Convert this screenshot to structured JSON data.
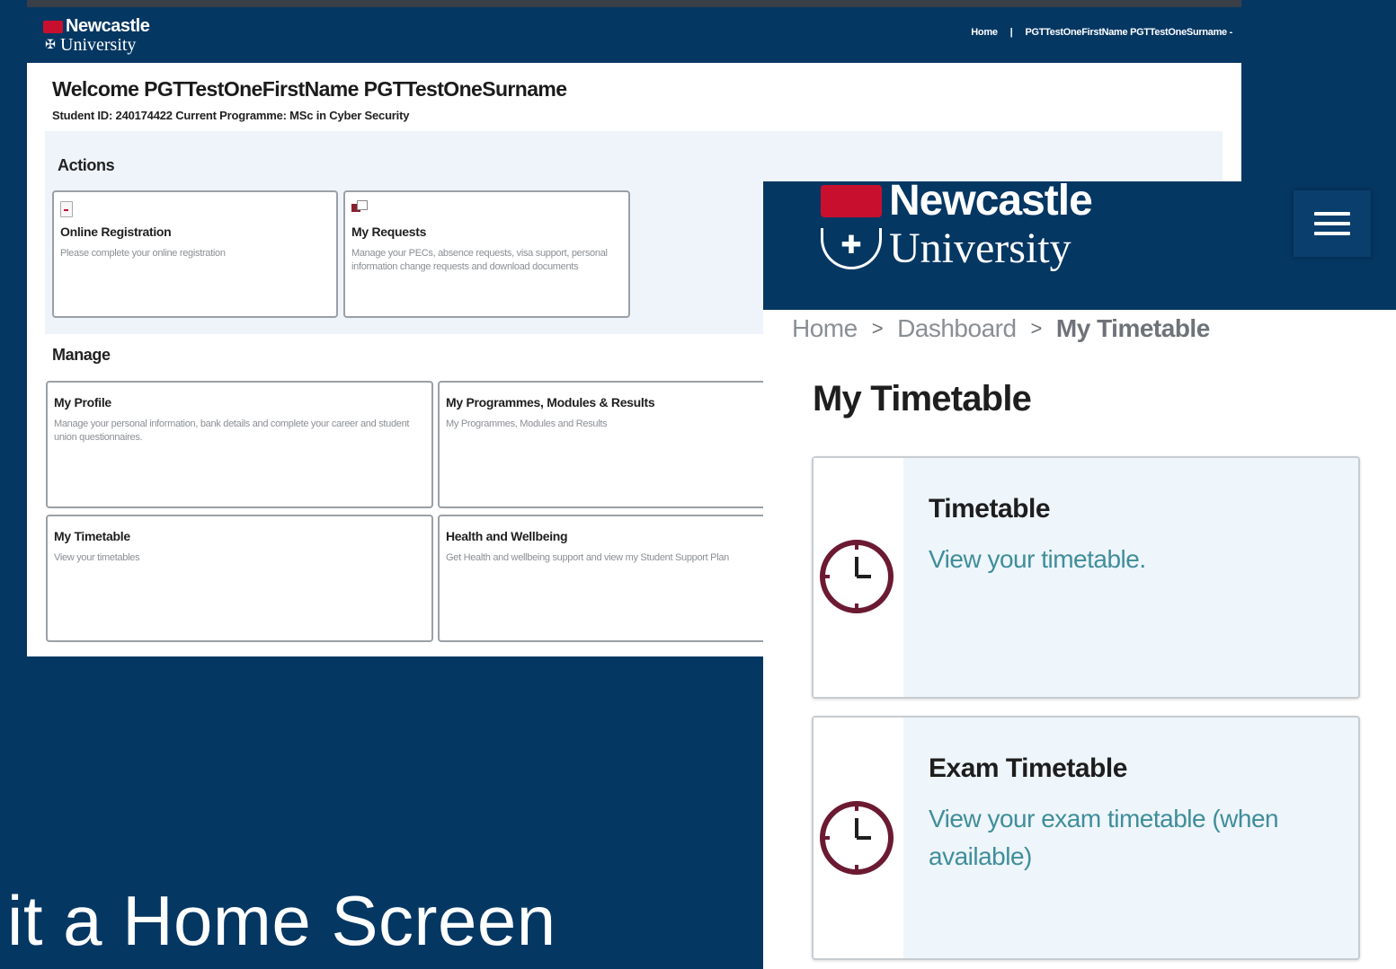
{
  "desktop": {
    "logo": {
      "line1": "Newcastle",
      "line2": "University"
    },
    "nav": {
      "home": "Home",
      "separator": "|",
      "user": "PGTTestOneFirstName PGTTestOneSurname -"
    },
    "welcome": "Welcome PGTTestOneFirstName PGTTestOneSurname",
    "student_info": "Student ID: 240174422 Current Programme: MSc in Cyber Security",
    "actions": {
      "title": "Actions",
      "cards": [
        {
          "title": "Online Registration",
          "desc": "Please complete your online registration",
          "icon": "document-icon"
        },
        {
          "title": "My Requests",
          "desc": "Manage your PECs, absence requests, visa support, personal information change requests and download documents",
          "icon": "requests-icon"
        }
      ]
    },
    "manage": {
      "title": "Manage",
      "cards": [
        {
          "title": "My Profile",
          "desc": "Manage your personal information, bank details and complete your career and student union questionnaires."
        },
        {
          "title": "My Programmes, Modules & Results",
          "desc": "My Programmes, Modules and Results"
        },
        {
          "title": "My Timetable",
          "desc": "View your timetables"
        },
        {
          "title": "Health and Wellbeing",
          "desc": "Get Health and wellbeing support and view my Student Support Plan"
        }
      ]
    }
  },
  "mobile": {
    "logo": {
      "line1": "Newcastle",
      "line2": "University"
    },
    "menu_icon": "hamburger-menu-icon",
    "breadcrumb": {
      "home": "Home",
      "sep": ">",
      "dashboard": "Dashboard",
      "current": "My Timetable"
    },
    "title": "My Timetable",
    "cards": [
      {
        "title": "Timetable",
        "desc": "View your timetable.",
        "icon": "clock-icon"
      },
      {
        "title": "Exam Timetable",
        "desc": "View your exam timetable (when available)",
        "icon": "clock-icon"
      }
    ]
  },
  "slide_text": "it a Home Screen",
  "colors": {
    "brand_navy": "#053763",
    "brand_red": "#c8102e",
    "clock_maroon": "#6b1a32",
    "link_teal": "#3f8e9a"
  }
}
